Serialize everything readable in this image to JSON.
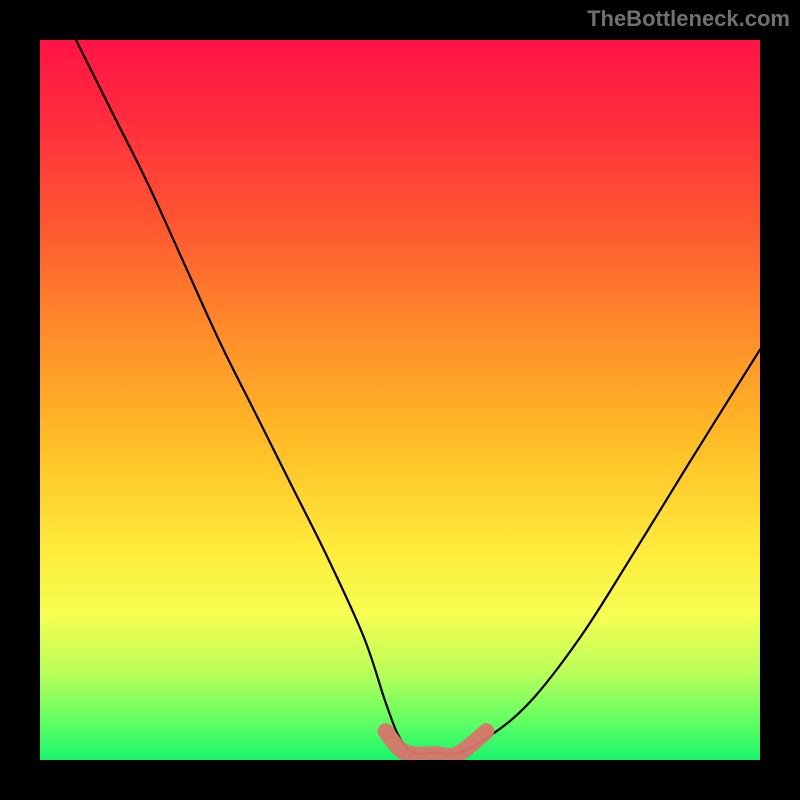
{
  "watermark": "TheBottleneck.com",
  "chart_data": {
    "type": "line",
    "title": "",
    "xlabel": "",
    "ylabel": "",
    "xlim": [
      0,
      100
    ],
    "ylim": [
      0,
      100
    ],
    "grid": false,
    "legend": false,
    "series": [
      {
        "name": "bottleneck-curve",
        "color": "#000000",
        "x": [
          5,
          10,
          15,
          20,
          25,
          30,
          35,
          40,
          45,
          48,
          50,
          52,
          55,
          58,
          62,
          68,
          75,
          82,
          90,
          100
        ],
        "y": [
          100,
          90,
          80,
          69,
          58,
          48,
          38,
          28,
          17,
          8,
          3,
          1,
          1,
          1,
          3,
          8,
          17,
          28,
          41,
          57
        ]
      },
      {
        "name": "highlight-band",
        "color": "#d9746b",
        "x": [
          48,
          50,
          52,
          55,
          58,
          62
        ],
        "y": [
          4,
          1.5,
          0.8,
          0.8,
          0.8,
          4
        ]
      }
    ],
    "background_gradient": {
      "top": "#ff1446",
      "bottom": "#17f56e"
    }
  }
}
